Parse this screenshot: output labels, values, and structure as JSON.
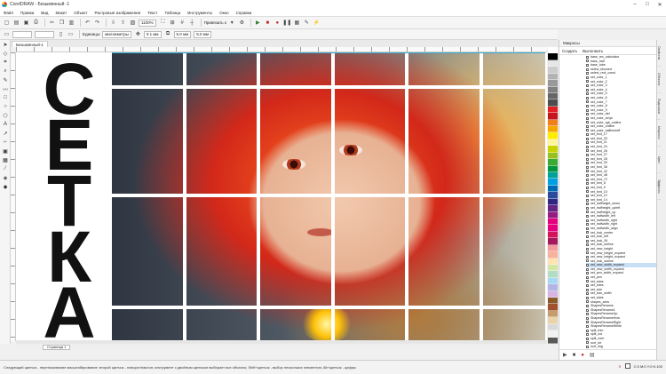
{
  "window": {
    "title": "CorelDRAW - Безымянный -1"
  },
  "menu": [
    "Файл",
    "Правка",
    "Вид",
    "Макет",
    "Объект",
    "Растровые изображения",
    "Текст",
    "Таблица",
    "Инструменты",
    "Окно",
    "Справка"
  ],
  "toolbar": {
    "zoom": "1100%",
    "snap_label": "Привязать к",
    "settings_label": "Запуск",
    "xy_x": "0.0 мм",
    "xy_y": "0.0 мм"
  },
  "property_bar": {
    "units_label": "Единицы:",
    "units_value": "миллиметры",
    "nudge": "0.1 мм",
    "dup_x": "5.0 мм",
    "dup_y": "5.0 мм"
  },
  "document_tab": "Безымянный-1",
  "canvas": {
    "letters": [
      "С",
      "Е",
      "Т",
      "К",
      "А"
    ]
  },
  "page_tabs": {
    "page": "Страница 1"
  },
  "panel": {
    "title": "Макросы",
    "toolbar": [
      "Создать",
      "Выполнить"
    ],
    "items": [
      "base_rec_calculator",
      "base_half",
      "base_tube",
      "select_blocked",
      "select_rect_const",
      "set_color_1",
      "set_color_2",
      "set_color_3",
      "set_color_4",
      "set_color_5",
      "set_color_6",
      "set_color_7",
      "set_color_8",
      "set_color_9",
      "set_color_def",
      "set_color_cmyk",
      "set_color_rgb_outline",
      "set_color_outline",
      "set_color_halftoneeff",
      "set_font_17",
      "set_font_20",
      "set_font_21",
      "set_font_24",
      "set_font_26",
      "set_font_27",
      "set_font_28",
      "set_font_30",
      "set_font_36",
      "set_font_42",
      "set_font_48",
      "set_font_72",
      "set_font_8",
      "set_font_9",
      "set_font_10",
      "set_font_12",
      "set_font_14",
      "set_halfheight_down",
      "set_halfheight_upleft",
      "set_halfheight_up",
      "set_halfwidth_left",
      "set_halfwidth_right",
      "set_halfwidth_right",
      "set_halfwidth_align",
      "set_lock_center",
      "set_lock_left",
      "set_lock_26",
      "set_lock_outline",
      "set_new_height",
      "set_new_height_expand",
      "set_new_height_expand",
      "set_lock_outline",
      "set_new_width_expand",
      "set_new_width_expand",
      "set_pen_width_expand",
      "set_pen",
      "set_stars",
      "set_stars",
      "set_size",
      "set_size_width",
      "set_stars",
      "shapes_area",
      "ShapesRename",
      "ShapesRename1",
      "ShapesRenameUp",
      "ShapesRenameHow",
      "ShapesRenameRight",
      "ShapesRenameWhite",
      "split_trim",
      "split_cut",
      "split_over",
      "sort_str",
      "sort_img"
    ],
    "selected_index": 51
  },
  "dockers": [
    "Свойства",
    "Объекты",
    "Подсказки",
    "Макросы",
    "Цвет",
    "Эффекты"
  ],
  "status": {
    "message": "Следующий щелчок - перетаскивание масштабирование; второй щелчок - поворот/наклон; инструмент с двойным щелчком выбирает все объекты; Shift+щелчок - выбор нескольких элементов; Alt+щелчок - цифры",
    "coords": "C:0 M:0 Y:0 K:100"
  },
  "palette_colors": [
    "#ffffff",
    "#000000",
    "#e6e6e6",
    "#cccccc",
    "#b3b3b3",
    "#999999",
    "#808080",
    "#666666",
    "#4d4d4d",
    "#e31e24",
    "#c4161c",
    "#ef7f1a",
    "#f7a600",
    "#ffed00",
    "#fff59d",
    "#c8d400",
    "#95c11f",
    "#3aaa35",
    "#009640",
    "#00a19a",
    "#00a0e3",
    "#0069b4",
    "#2a4a9b",
    "#312783",
    "#662483",
    "#951b81",
    "#e6007e",
    "#e5007d",
    "#d4145a",
    "#a3195b",
    "#f39c9c",
    "#f6b29a",
    "#ffe3b3",
    "#d4e6a5",
    "#b3dcc5",
    "#a5d8f3",
    "#b3b3e6",
    "#d9b3e6",
    "#8b5a2b",
    "#a0522d",
    "#c69c6d",
    "#e8d4a8",
    "#d9d9d9",
    "#f2f2f2",
    "#595959"
  ]
}
